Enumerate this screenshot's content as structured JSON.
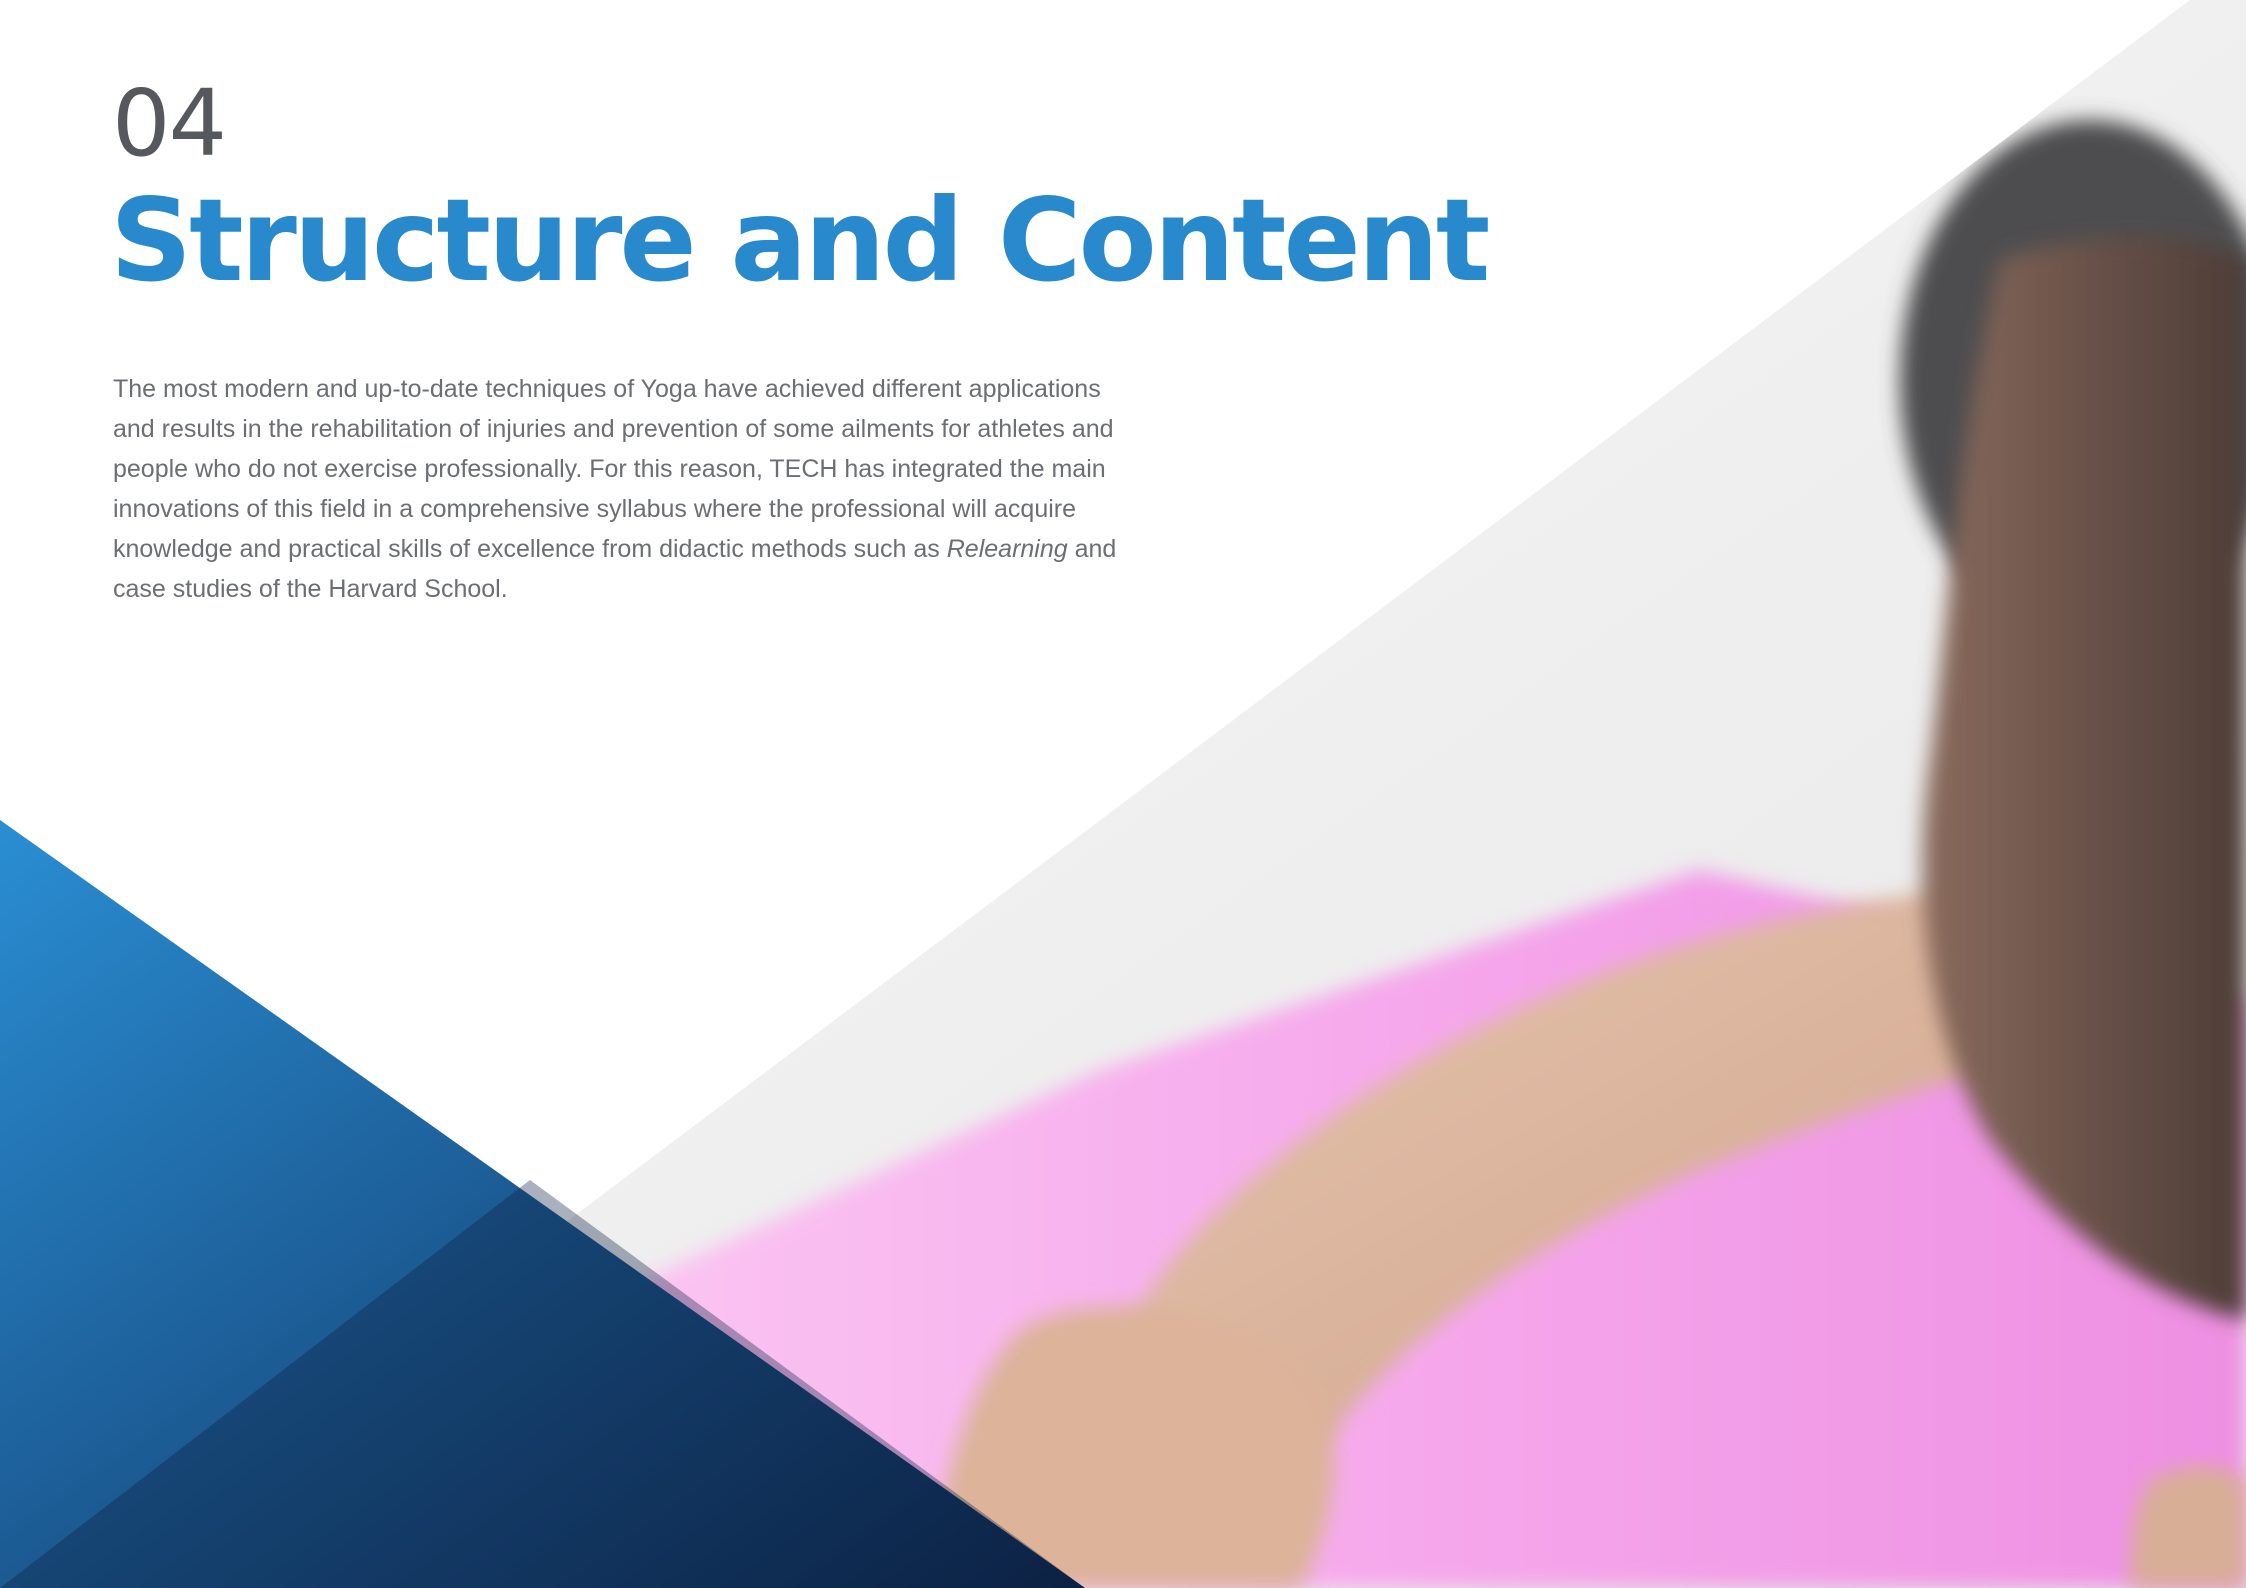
{
  "section": {
    "number": "04",
    "title": "Structure and Content"
  },
  "intro": {
    "text_before": "The most modern and up-to-date techniques of Yoga have achieved different applications and results in the rehabilitation of injuries and prevention of some ailments for athletes and people who do not exercise professionally. For this reason, TECH has integrated the main innovations of this field in a comprehensive syllabus where the professional will acquire knowledge and practical skills of excellence from didactic methods such as",
    "emphasis": "Relearning",
    "text_after": " and case studies of the Harvard School."
  },
  "colors": {
    "accent_blue": "#2889cc",
    "dark_navy": "#0f2e56",
    "mat_pink": "#f39de8",
    "text_gray": "#6b6e72",
    "number_gray": "#55585d"
  }
}
